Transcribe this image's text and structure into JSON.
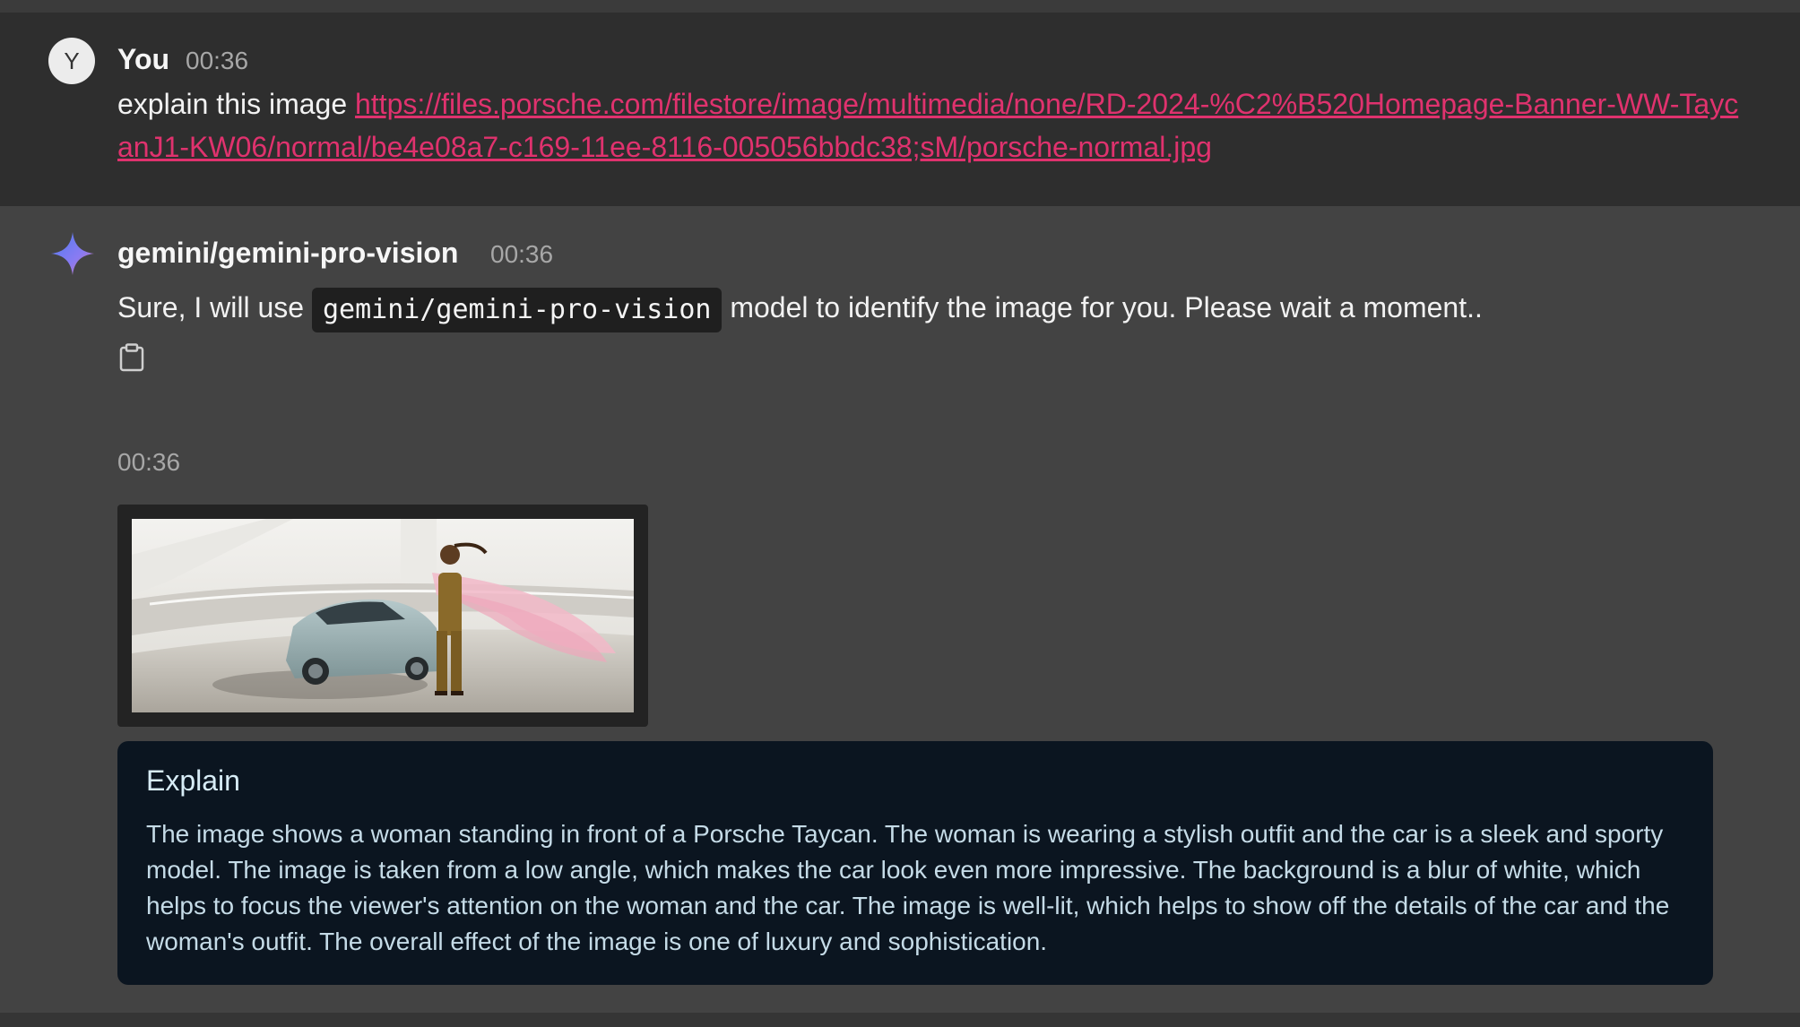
{
  "user_message": {
    "avatar_letter": "Y",
    "sender": "You",
    "time": "00:36",
    "text_prefix": "explain this image ",
    "link": "https://files.porsche.com/filestore/image/multimedia/none/RD-2024-%C2%B520Homepage-Banner-WW-TaycanJ1-KW06/normal/be4e08a7-c169-11ee-8116-005056bbdc38;sM/porsche-normal.jpg"
  },
  "bot_message": {
    "icon": "sparkle-icon",
    "sender": "gemini/gemini-pro-vision",
    "time": "00:36",
    "text_before": "Sure, I will use ",
    "code": "gemini/gemini-pro-vision",
    "text_after": " model to identify the image for you. Please wait a moment..",
    "copy_icon": "clipboard-icon"
  },
  "image_message": {
    "time": "00:36"
  },
  "explain": {
    "title": "Explain",
    "body": "The image shows a woman standing in front of a Porsche Taycan. The woman is wearing a stylish outfit and the car is a sleek and sporty model. The image is taken from a low angle, which makes the car look even more impressive. The background is a blur of white, which helps to focus the viewer's attention on the woman and the car. The image is well-lit, which helps to show off the details of the car and the woman's outfit. The overall effect of the image is one of luxury and sophistication."
  },
  "colors": {
    "link": "#e0326e",
    "user_bg": "#2e2e2e",
    "bot_bg": "#434343",
    "explain_bg": "#0b1520"
  }
}
